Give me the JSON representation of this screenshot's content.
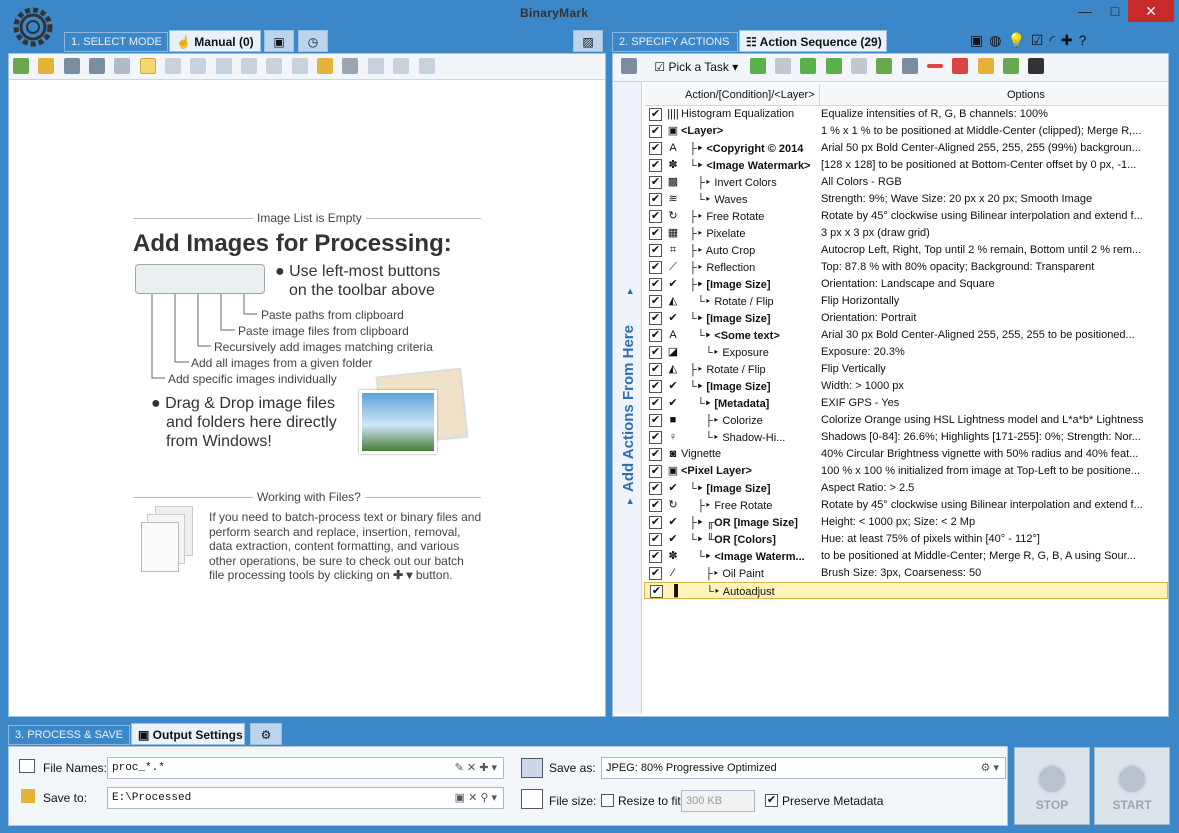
{
  "brand": "BinaryMark",
  "steps": {
    "select_mode": "1. SELECT MODE",
    "specify_actions": "2. SPECIFY ACTIONS",
    "process_save": "3. PROCESS & SAVE"
  },
  "tabs": {
    "manual": "Manual (0)",
    "action_sequence": "Action Sequence (29)",
    "output_settings": "Output Settings"
  },
  "left": {
    "empty_caption": "Image List is Empty",
    "title": "Add Images for Processing:",
    "hint1": "Use left-most buttons",
    "hint1b": "on the toolbar above",
    "callouts": [
      "Paste paths from clipboard",
      "Paste image files from clipboard",
      "Recursively add images matching criteria",
      "Add all images from a given folder",
      "Add specific images individually"
    ],
    "dnd1": "Drag & Drop image files",
    "dnd2": "and folders here directly",
    "dnd3": "from Windows!",
    "files_caption": "Working with Files?",
    "files_text1": "If you need to batch-process text or binary files and",
    "files_text2": "perform search and replace, insertion, removal,",
    "files_text3": "data extraction, content formatting, and various",
    "files_text4": "other operations, be sure to check out our batch",
    "files_text5": "file processing tools by clicking on",
    "files_text6": "button."
  },
  "right": {
    "pick_task": "Pick a Task",
    "col_action": "Action/[Condition]/<Layer>",
    "col_options": "Options",
    "side_label": "Add Actions From Here",
    "rows": [
      {
        "icon": "||||",
        "action": "Histogram Equalization",
        "options": "Equalize intensities of R, G, B channels: 100%",
        "bold": false,
        "indent": 0
      },
      {
        "icon": "▣",
        "action": "<Layer>",
        "options": "1 % x 1 % to be positioned at Middle-Center (clipped); Merge R,...",
        "bold": true,
        "indent": 0
      },
      {
        "icon": "A",
        "action": "├‣ <Copyright © 2014",
        "options": "Arial 50 px Bold Center-Aligned 255, 255, 255 (99%) backgroun...",
        "bold": true,
        "indent": 1
      },
      {
        "icon": "✽",
        "action": "└‣ <Image Watermark>",
        "options": "[128 x 128] to be positioned at Bottom-Center offset by 0 px, -1...",
        "bold": true,
        "indent": 1
      },
      {
        "icon": "▩",
        "action": "├‣ Invert Colors",
        "options": "All Colors - RGB",
        "bold": false,
        "indent": 2
      },
      {
        "icon": "≋",
        "action": "└‣ Waves",
        "options": "Strength: 9%; Wave Size: 20 px x 20 px; Smooth Image",
        "bold": false,
        "indent": 2
      },
      {
        "icon": "↻",
        "action": "├‣ Free Rotate",
        "options": "Rotate by 45° clockwise using Bilinear interpolation and extend f...",
        "bold": false,
        "indent": 1
      },
      {
        "icon": "▦",
        "action": "├‣ Pixelate",
        "options": "3 px x 3 px (draw grid)",
        "bold": false,
        "indent": 1
      },
      {
        "icon": "⌗",
        "action": "├‣ Auto Crop",
        "options": "Autocrop Left, Right, Top until 2 % remain, Bottom until 2 % rem...",
        "bold": false,
        "indent": 1
      },
      {
        "icon": "⟋",
        "action": "├‣ Reflection",
        "options": "Top: 87.8 % with 80% opacity; Background: Transparent",
        "bold": false,
        "indent": 1
      },
      {
        "icon": "✔",
        "action": "├‣ [Image Size]",
        "options": "Orientation: Landscape and Square",
        "bold": true,
        "indent": 1
      },
      {
        "icon": "◭",
        "action": "└‣ Rotate / Flip",
        "options": "Flip Horizontally",
        "bold": false,
        "indent": 2
      },
      {
        "icon": "✔",
        "action": "└‣ [Image Size]",
        "options": "Orientation: Portrait",
        "bold": true,
        "indent": 1
      },
      {
        "icon": "A",
        "action": "└‣ <Some text>",
        "options": "Arial 30 px Bold Center-Aligned 255, 255, 255 to be positioned...",
        "bold": true,
        "indent": 2
      },
      {
        "icon": "◪",
        "action": "└‣ Exposure",
        "options": "Exposure: 20.3%",
        "bold": false,
        "indent": 3
      },
      {
        "icon": "◭",
        "action": "├‣ Rotate / Flip",
        "options": "Flip Vertically",
        "bold": false,
        "indent": 1
      },
      {
        "icon": "✔",
        "action": "└‣ [Image Size]",
        "options": "Width: > 1000 px",
        "bold": true,
        "indent": 1
      },
      {
        "icon": "✔",
        "action": "└‣ [Metadata]",
        "options": "EXIF GPS - Yes",
        "bold": true,
        "indent": 2
      },
      {
        "icon": "■",
        "action": "├‣ Colorize",
        "options": "Colorize Orange using HSL Lightness model and L*a*b* Lightness",
        "bold": false,
        "indent": 3
      },
      {
        "icon": "♀",
        "action": "└‣ Shadow-Hi...",
        "options": "Shadows [0-84]: 26.6%; Highlights [171-255]: 0%; Strength: Nor...",
        "bold": false,
        "indent": 3
      },
      {
        "icon": "◙",
        "action": "Vignette",
        "options": "40% Circular Brightness vignette with 50% radius and 40% feat...",
        "bold": false,
        "indent": 0
      },
      {
        "icon": "▣",
        "action": "<Pixel Layer>",
        "options": "100 % x 100 % initialized from image at Top-Left to be positione...",
        "bold": true,
        "indent": 0
      },
      {
        "icon": "✔",
        "action": "└‣ [Image Size]",
        "options": "Aspect Ratio: > 2.5",
        "bold": true,
        "indent": 1
      },
      {
        "icon": "↻",
        "action": "├‣ Free Rotate",
        "options": "Rotate by 45° clockwise using Bilinear interpolation and extend f...",
        "bold": false,
        "indent": 2
      },
      {
        "icon": "✔",
        "action": "├‣ ╓OR [Image Size]",
        "options": "Height: < 1000 px; Size: < 2 Mp",
        "bold": true,
        "indent": 1
      },
      {
        "icon": "✔",
        "action": "└‣ ╙OR [Colors]",
        "options": "Hue: at least 75% of pixels within [40° - 112°]",
        "bold": true,
        "indent": 1
      },
      {
        "icon": "✽",
        "action": "└‣ <Image Waterm...",
        "options": "to be positioned at Middle-Center; Merge R, G, B, A using Sour...",
        "bold": true,
        "indent": 2
      },
      {
        "icon": "∕",
        "action": "├‣ Oil Paint",
        "options": "Brush Size: 3px, Coarseness: 50",
        "bold": false,
        "indent": 3
      },
      {
        "icon": "▐",
        "action": "└‣ Autoadjust",
        "options": "",
        "bold": false,
        "indent": 3,
        "selected": true
      }
    ]
  },
  "output": {
    "file_names_label": "File Names:",
    "file_names_value": "proc_*.*",
    "save_to_label": "Save to:",
    "save_to_value": "E:\\Processed",
    "save_as_label": "Save as:",
    "save_as_value": "JPEG: 80%  Progressive Optimized",
    "file_size_label": "File size:",
    "resize_label": "Resize to fit:",
    "resize_value": "300 KB",
    "preserve_label": "Preserve Metadata",
    "stop": "STOP",
    "start": "START"
  }
}
